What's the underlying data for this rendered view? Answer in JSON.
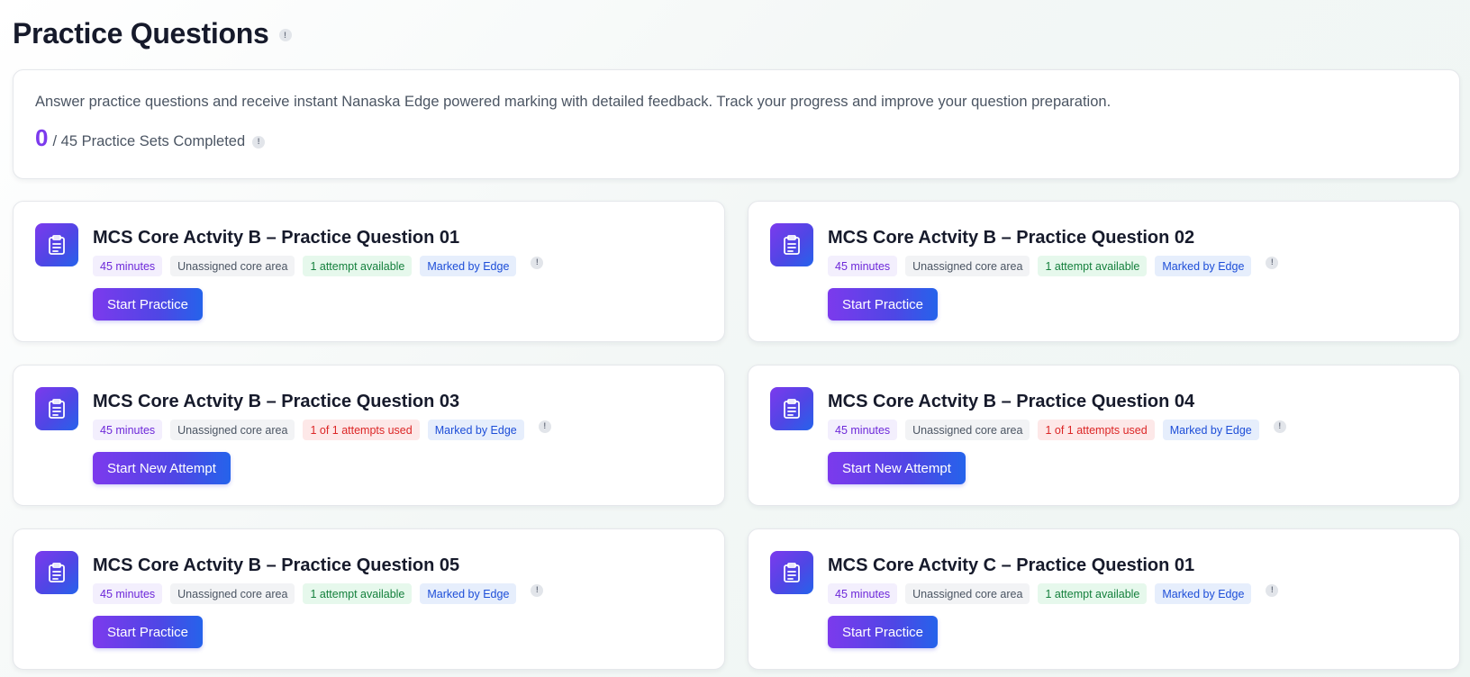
{
  "header": {
    "title": "Practice Questions",
    "info_icon": "info-icon",
    "info_glyph": "!"
  },
  "intro": {
    "description": "Answer practice questions and receive instant Nanaska Edge powered marking with detailed feedback. Track your progress and improve your question preparation.",
    "completed_count": "0",
    "completed_label": "/ 45 Practice Sets Completed",
    "info_glyph": "!"
  },
  "colors": {
    "accent_purple": "#7c3aed",
    "accent_blue": "#2563eb",
    "tag_available": "#15803d",
    "tag_used": "#dc2626"
  },
  "cards": [
    {
      "title": "MCS Core Actvity B – Practice Question 01",
      "icon": "clipboard-icon",
      "tags": {
        "duration": "45 minutes",
        "area": "Unassigned core area",
        "attempts": "1 attempt available",
        "marking": "Marked by Edge"
      },
      "attempts_status": "available",
      "button_label": "Start Practice"
    },
    {
      "title": "MCS Core Actvity B – Practice Question 02",
      "icon": "clipboard-icon",
      "tags": {
        "duration": "45 minutes",
        "area": "Unassigned core area",
        "attempts": "1 attempt available",
        "marking": "Marked by Edge"
      },
      "attempts_status": "available",
      "button_label": "Start Practice"
    },
    {
      "title": "MCS Core Actvity B – Practice Question 03",
      "icon": "clipboard-icon",
      "tags": {
        "duration": "45 minutes",
        "area": "Unassigned core area",
        "attempts": "1 of 1 attempts used",
        "marking": "Marked by Edge"
      },
      "attempts_status": "used",
      "button_label": "Start New Attempt"
    },
    {
      "title": "MCS Core Actvity B – Practice Question 04",
      "icon": "clipboard-icon",
      "tags": {
        "duration": "45 minutes",
        "area": "Unassigned core area",
        "attempts": "1 of 1 attempts used",
        "marking": "Marked by Edge"
      },
      "attempts_status": "used",
      "button_label": "Start New Attempt"
    },
    {
      "title": "MCS Core Actvity B – Practice Question 05",
      "icon": "clipboard-icon",
      "tags": {
        "duration": "45 minutes",
        "area": "Unassigned core area",
        "attempts": "1 attempt available",
        "marking": "Marked by Edge"
      },
      "attempts_status": "available",
      "button_label": "Start Practice"
    },
    {
      "title": "MCS Core Actvity C – Practice Question 01",
      "icon": "clipboard-icon",
      "tags": {
        "duration": "45 minutes",
        "area": "Unassigned core area",
        "attempts": "1 attempt available",
        "marking": "Marked by Edge"
      },
      "attempts_status": "available",
      "button_label": "Start Practice"
    }
  ]
}
